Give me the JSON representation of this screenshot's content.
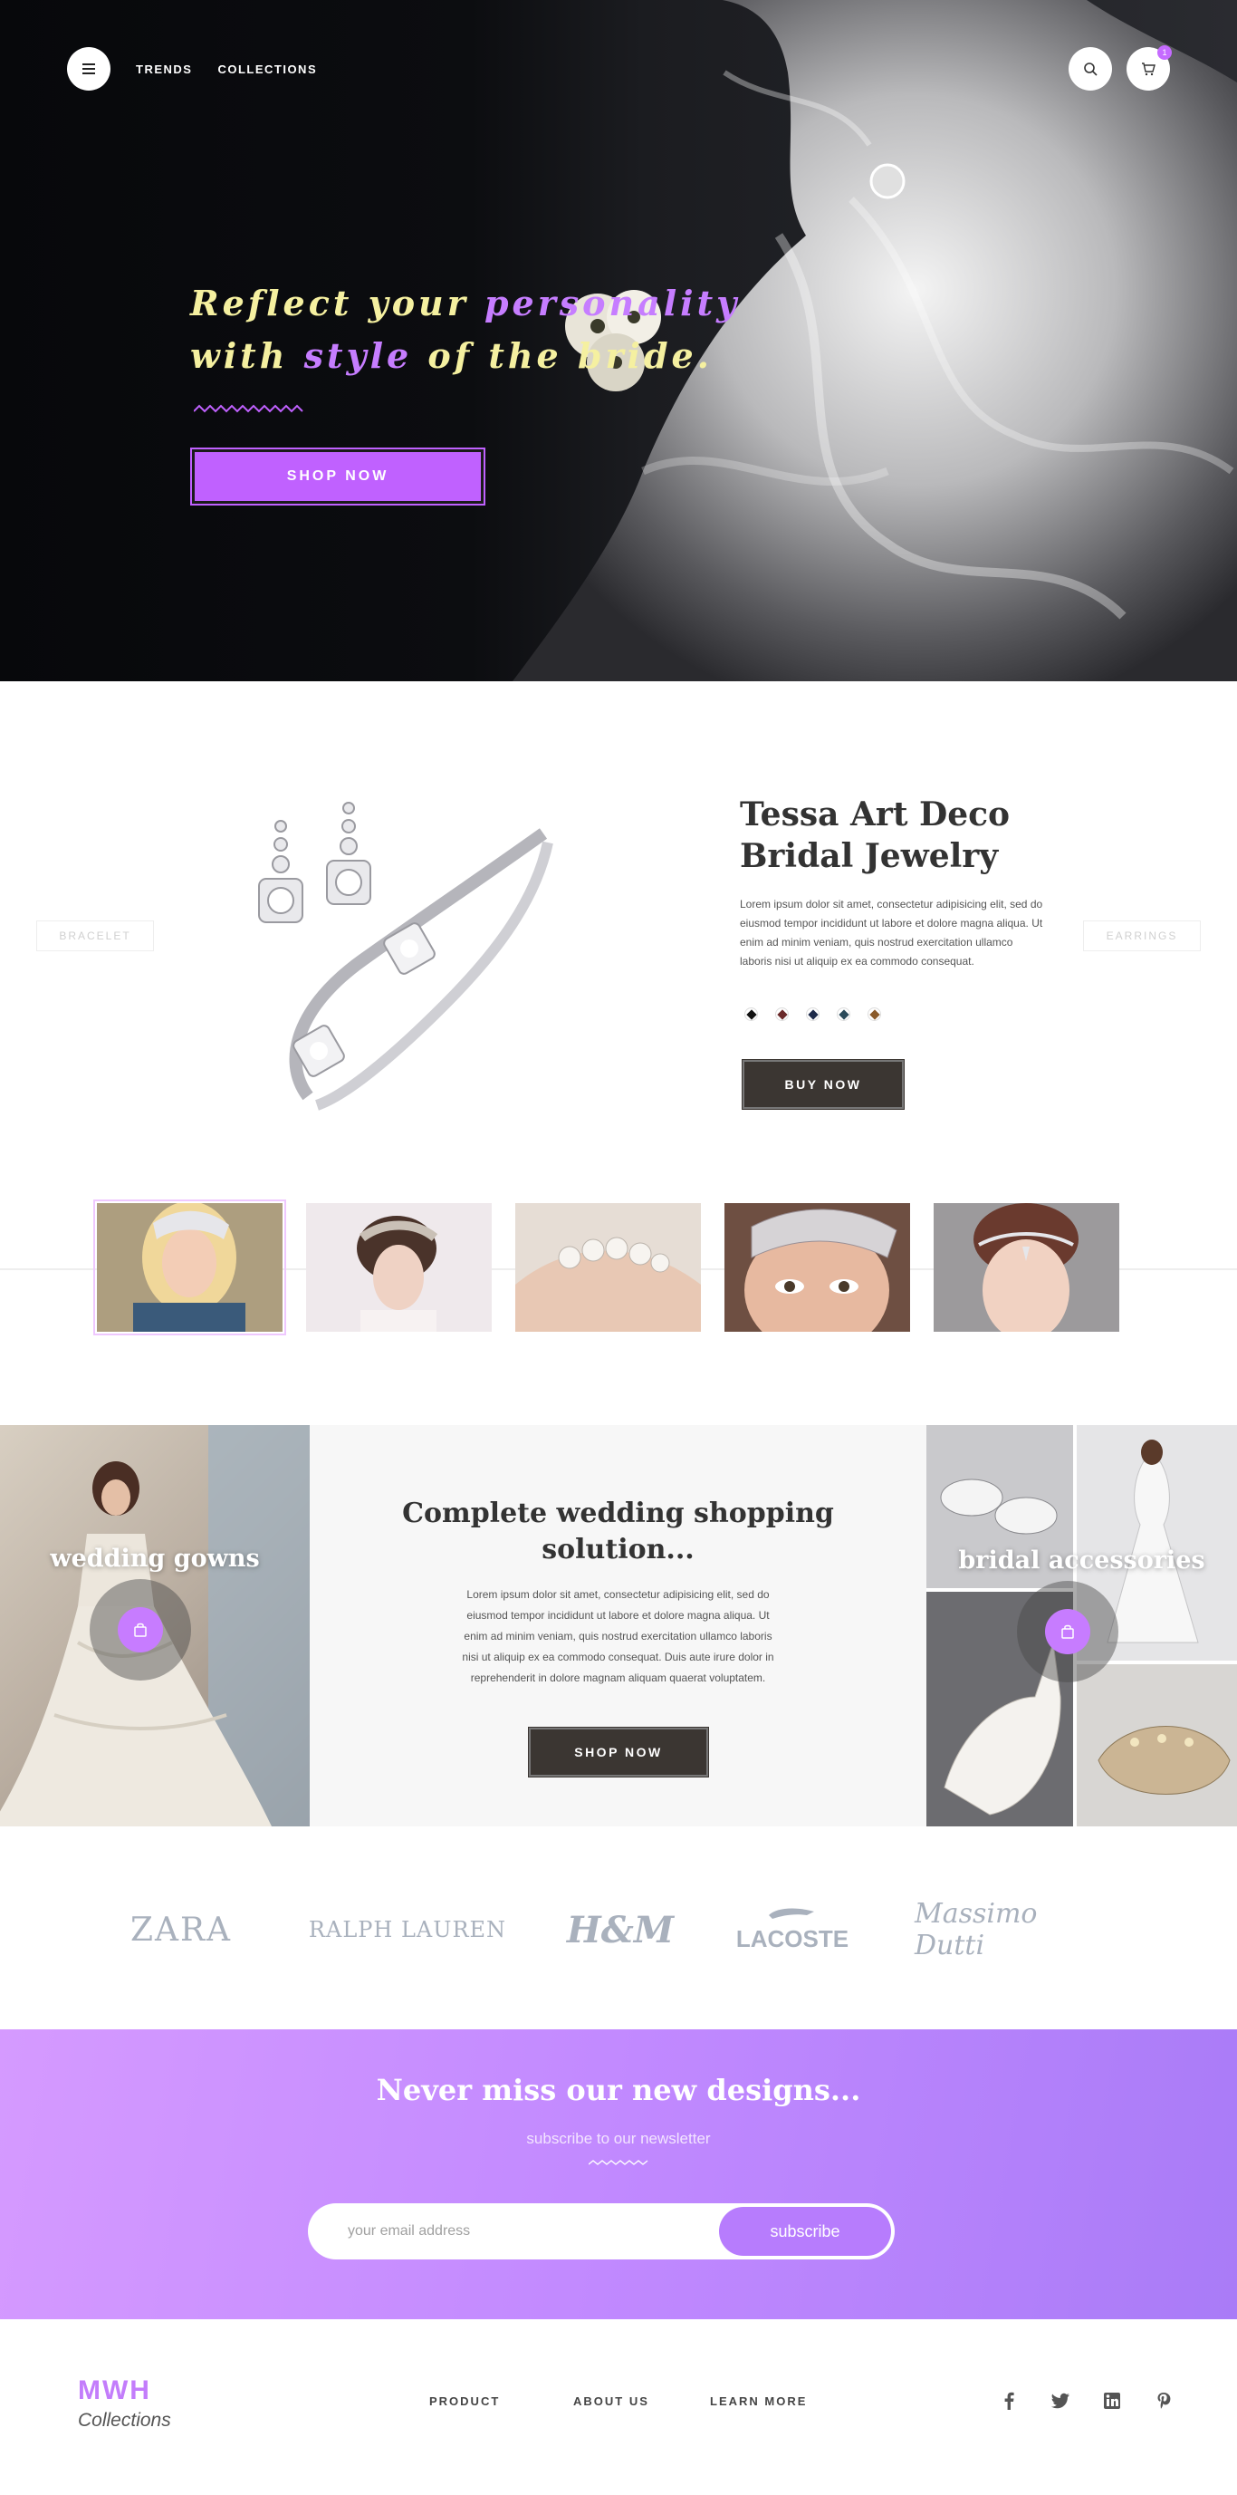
{
  "nav": {
    "links": [
      "TRENDS",
      "COLLECTIONS"
    ],
    "cart_count": "1"
  },
  "hero": {
    "line1_a": "Reflect your ",
    "line1_b": "personality",
    "line2_a": "with ",
    "line2_b": "style",
    "line2_c": " of the bride.",
    "cta": "SHOP NOW",
    "title_color": "#f5f0a0",
    "accent_color": "#c67dff"
  },
  "product": {
    "title_line1": "Tessa Art Deco",
    "title_line2": "Bridal Jewelry",
    "description": "Lorem ipsum dolor sit amet, consectetur adipisicing elit, sed do eiusmod tempor incididunt ut labore et dolore magna aliqua. Ut enim ad minim veniam, quis nostrud exercitation ullamco laboris nisi ut aliquip ex ea commodo consequat.",
    "prev_label": "BRACELET",
    "next_label": "EARRINGS",
    "swatches": [
      "#111111",
      "#6b2a2a",
      "#1d2a4a",
      "#2a4a5a",
      "#8a5a2a"
    ],
    "buy_label": "BUY NOW"
  },
  "categories": {
    "left_label": "wedding gowns",
    "right_label": "bridal accessories",
    "center_title_line1": "Complete wedding shopping",
    "center_title_line2": "solution...",
    "center_desc": "Lorem ipsum dolor sit amet, consectetur adipisicing elit, sed do eiusmod tempor incididunt ut labore et dolore magna aliqua. Ut enim ad minim veniam, quis nostrud exercitation ullamco laboris nisi ut aliquip ex ea commodo consequat. Duis aute irure dolor in reprehenderit in  dolore magnam aliquam quaerat voluptatem.",
    "center_cta": "SHOP NOW"
  },
  "brands": [
    "ZARA",
    "RALPH LAUREN",
    "H&M",
    "LACOSTE",
    "Massimo Dutti"
  ],
  "newsletter": {
    "title": "Never miss our new designs...",
    "subtitle": "subscribe to our newsletter",
    "placeholder": "your email address",
    "button": "subscribe"
  },
  "footer": {
    "logo_main": "MWH",
    "logo_sub": "Collections",
    "links": [
      "PRODUCT",
      "ABOUT US",
      "LEARN MORE"
    ]
  },
  "social": [
    "facebook-icon",
    "twitter-icon",
    "linkedin-icon",
    "pinterest-icon"
  ]
}
